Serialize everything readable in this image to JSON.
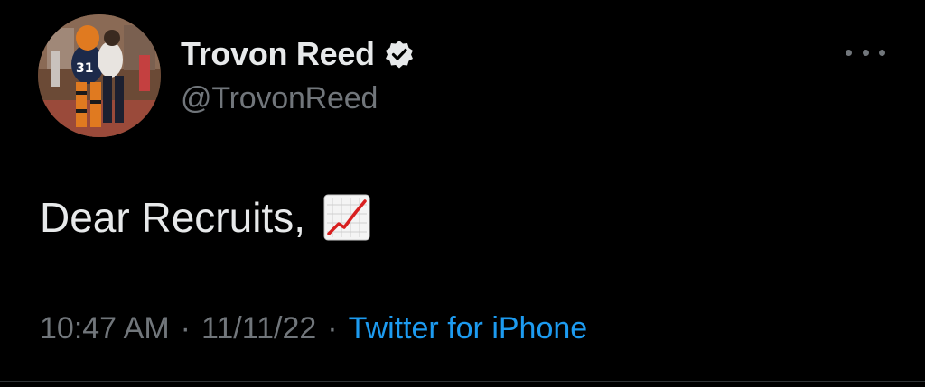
{
  "author": {
    "display_name": "Trovon Reed",
    "handle": "@TrovonReed",
    "verified": true,
    "avatar_icon": "profile-photo"
  },
  "tweet": {
    "text": "Dear Recruits,",
    "emoji": "chart-increasing-emoji"
  },
  "meta": {
    "time": "10:47 AM",
    "date": "11/11/22",
    "separator": "·",
    "source": "Twitter for iPhone"
  },
  "colors": {
    "background": "#000000",
    "primary_text": "#e7e9ea",
    "secondary_text": "#71767b",
    "link": "#1d9bf0"
  }
}
